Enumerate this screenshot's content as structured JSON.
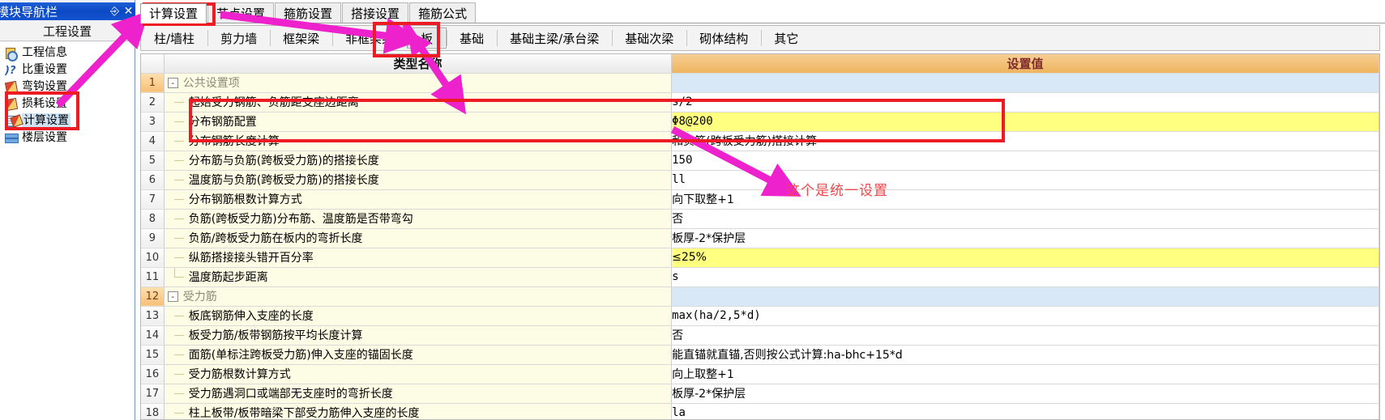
{
  "nav": {
    "title": "模块导航栏",
    "pin_icon": "pin-icon",
    "close_icon": "close-icon",
    "section_title": "工程设置",
    "items": [
      {
        "label": "工程信息",
        "icon": "project-info-icon",
        "selected": false
      },
      {
        "label": "比重设置",
        "icon": "weight-ratio-icon",
        "selected": false
      },
      {
        "label": "弯钩设置",
        "icon": "hook-settings-icon",
        "selected": false
      },
      {
        "label": "损耗设置",
        "icon": "loss-settings-icon",
        "selected": false
      },
      {
        "label": "计算设置",
        "icon": "calc-settings-icon",
        "selected": true
      },
      {
        "label": "楼层设置",
        "icon": "floor-settings-icon",
        "selected": false
      }
    ]
  },
  "top_tabs": [
    {
      "label": "计算设置",
      "active": true
    },
    {
      "label": "节点设置",
      "active": false
    },
    {
      "label": "箍筋设置",
      "active": false
    },
    {
      "label": "搭接设置",
      "active": false
    },
    {
      "label": "箍筋公式",
      "active": false
    }
  ],
  "sub_tabs": [
    {
      "label": "柱/墙柱",
      "active": false
    },
    {
      "label": "剪力墙",
      "active": false
    },
    {
      "label": "框架梁",
      "active": false
    },
    {
      "label": "非框架梁",
      "active": false
    },
    {
      "label": "板",
      "active": true
    },
    {
      "label": "基础",
      "active": false
    },
    {
      "label": "基础主梁/承台梁",
      "active": false
    },
    {
      "label": "基础次梁",
      "active": false
    },
    {
      "label": "砌体结构",
      "active": false
    },
    {
      "label": "其它",
      "active": false
    }
  ],
  "grid": {
    "headers": {
      "rownum": "",
      "name": "类型名称",
      "value": "设置值"
    },
    "rows": [
      {
        "num": "1",
        "type": "group",
        "toggle": "-",
        "name": "公共设置项",
        "value": ""
      },
      {
        "num": "2",
        "type": "item",
        "name": "起始受力钢筋、负筋距支座边距离",
        "value": "s/2",
        "mono": true
      },
      {
        "num": "3",
        "type": "item",
        "name": "分布钢筋配置",
        "value": "Φ8@200",
        "highlight": true,
        "mono": true
      },
      {
        "num": "4",
        "type": "item",
        "name": "分布钢筋长度计算",
        "value": "和负筋(跨板受力筋)搭接计算"
      },
      {
        "num": "5",
        "type": "item",
        "name": "分布筋与负筋(跨板受力筋)的搭接长度",
        "value": "150",
        "mono": true
      },
      {
        "num": "6",
        "type": "item",
        "name": "温度筋与负筋(跨板受力筋)的搭接长度",
        "value": "ll",
        "mono": true
      },
      {
        "num": "7",
        "type": "item",
        "name": "分布钢筋根数计算方式",
        "value": "向下取整+1"
      },
      {
        "num": "8",
        "type": "item",
        "name": "负筋(跨板受力筋)分布筋、温度筋是否带弯勾",
        "value": "否"
      },
      {
        "num": "9",
        "type": "item",
        "name": "负筋/跨板受力筋在板内的弯折长度",
        "value": "板厚-2*保护层"
      },
      {
        "num": "10",
        "type": "item",
        "name": "纵筋搭接接头错开百分率",
        "value": "≤25%",
        "highlight": true
      },
      {
        "num": "11",
        "type": "item",
        "name": "温度筋起步距离",
        "value": "s",
        "mono": true,
        "last": true
      },
      {
        "num": "12",
        "type": "group",
        "toggle": "-",
        "name": "受力筋",
        "value": ""
      },
      {
        "num": "13",
        "type": "item",
        "name": "板底钢筋伸入支座的长度",
        "value": "max(ha/2,5*d)",
        "mono": true
      },
      {
        "num": "14",
        "type": "item",
        "name": "板受力筋/板带钢筋按平均长度计算",
        "value": "否"
      },
      {
        "num": "15",
        "type": "item",
        "name": "面筋(单标注跨板受力筋)伸入支座的锚固长度",
        "value": "能直锚就直锚,否则按公式计算:ha-bhc+15*d"
      },
      {
        "num": "16",
        "type": "item",
        "name": "受力筋根数计算方式",
        "value": "向上取整+1"
      },
      {
        "num": "17",
        "type": "item",
        "name": "受力筋遇洞口或端部无支座时的弯折长度",
        "value": "板厚-2*保护层"
      },
      {
        "num": "18",
        "type": "item",
        "name": "柱上板带/板带暗梁下部受力筋伸入支座的长度",
        "value": "la",
        "mono": true
      }
    ]
  },
  "annotations": {
    "note_text": "这个是统一设置",
    "highlight_color": "#ed1c24",
    "arrow_color": "#ee22cc",
    "note_color": "#f0474b"
  }
}
